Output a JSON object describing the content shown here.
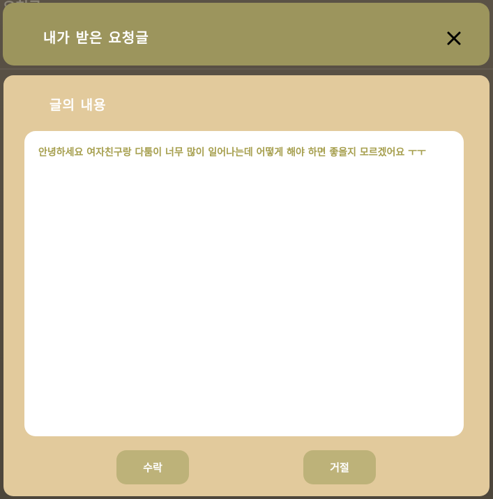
{
  "background": {
    "ghost_title": "요청글"
  },
  "header": {
    "title": "내가 받은 요청글",
    "close_icon": "close-icon",
    "color": "#9c955d"
  },
  "panel": {
    "section_label": "글의 내용",
    "content": "안녕하세요 여자친구랑 다툼이 너무 많이 일어나는데 어떻게 해야 하면 좋을지 모르겠어요 ㅜㅜ",
    "background_color": "#e2ca9c",
    "text_color": "#a69f4e"
  },
  "actions": {
    "accept_label": "수락",
    "reject_label": "거절",
    "button_color": "#bdb279"
  }
}
